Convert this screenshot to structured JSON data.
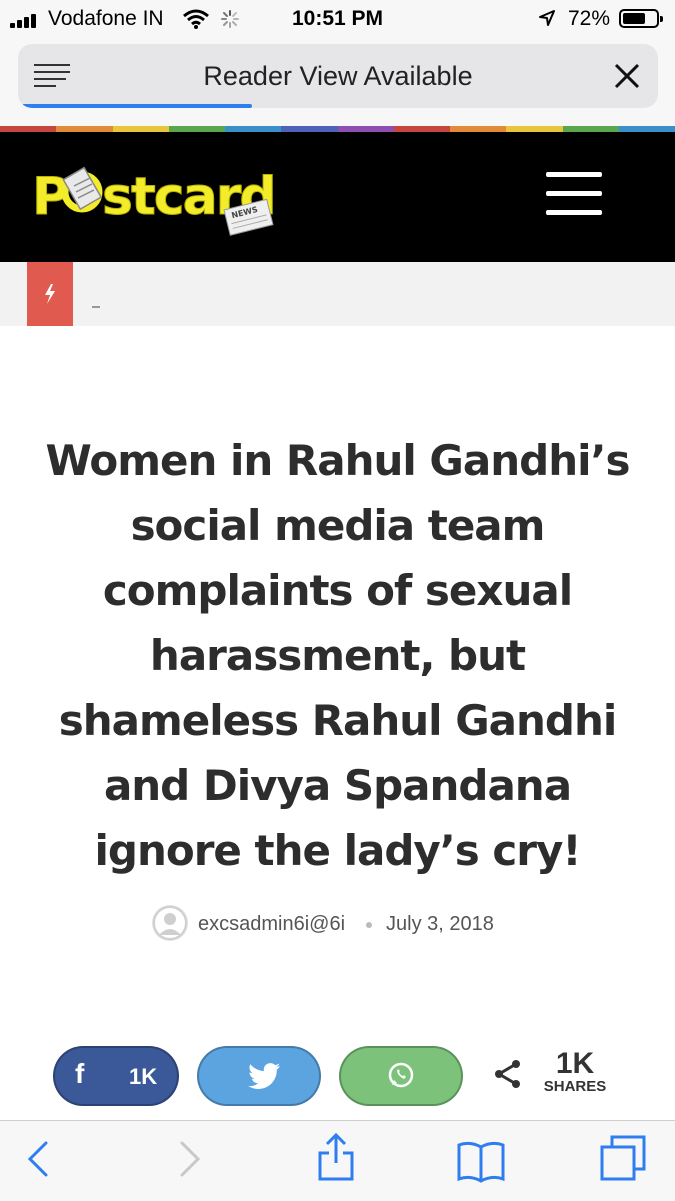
{
  "status_bar": {
    "carrier": "Vodafone IN",
    "time": "10:51 PM",
    "battery_percent": "72%",
    "battery_level": 0.72
  },
  "browser": {
    "url_text": "Reader View Available",
    "load_progress": 0.36
  },
  "site": {
    "name": "Postcard",
    "logo_badge": "NEWS",
    "colors": {
      "header_bg": "#000000",
      "logo_yellow": "#f2ec2a",
      "breaking_red": "#e05a50"
    }
  },
  "article": {
    "title": "Women in Rahul Gandhi’s social media team complaints of sexual harassment, but shameless Rahul Gandhi and Divya Spandana ignore the lady’s cry!",
    "author": "excsadmin6i@6i",
    "date": "July 3, 2018"
  },
  "share": {
    "facebook_count": "1K",
    "total_count": "1K",
    "total_label": "SHARES",
    "colors": {
      "facebook": "#3b5998",
      "twitter": "#5ba4e0",
      "whatsapp": "#7cc27b"
    }
  },
  "toolbar": {
    "icons": [
      "back-icon",
      "forward-icon",
      "share-icon",
      "bookmarks-icon",
      "tabs-icon"
    ]
  }
}
